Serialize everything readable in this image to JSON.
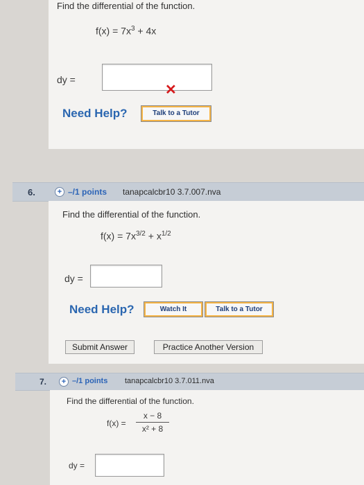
{
  "q5": {
    "prompt": "Find the differential of the function.",
    "f_lhs": "f(x) = 7x",
    "f_exp": "3",
    "f_rest": " + 4x",
    "dy_label": "dy =",
    "answer": "",
    "status_mark": "✕",
    "need_help": "Need Help?",
    "talk_tutor": "Talk to a Tutor"
  },
  "q6": {
    "number": "6.",
    "points": "–/1 points",
    "source": "tanapcalcbr10 3.7.007.nva",
    "prompt": "Find the differential of the function.",
    "f_lhs": "f(x) = 7x",
    "f_exp1": "3/2",
    "f_mid": " + x",
    "f_exp2": "1/2",
    "dy_label": "dy =",
    "answer": "",
    "need_help": "Need Help?",
    "watch_it": "Watch It",
    "talk_tutor": "Talk to a Tutor",
    "submit": "Submit Answer",
    "practice": "Practice Another Version"
  },
  "q7": {
    "number": "7.",
    "points": "–/1 points",
    "source": "tanapcalcbr10 3.7.011.nva",
    "prompt": "Find the differential of the function.",
    "f_lhs": "f(x) =",
    "numerator": "x − 8",
    "denominator": "x² + 8",
    "dy_label": "dy =",
    "answer": ""
  },
  "colors": {
    "link_blue": "#2c64b7",
    "error_red": "#d6191b",
    "button_border": "#f6b445"
  }
}
